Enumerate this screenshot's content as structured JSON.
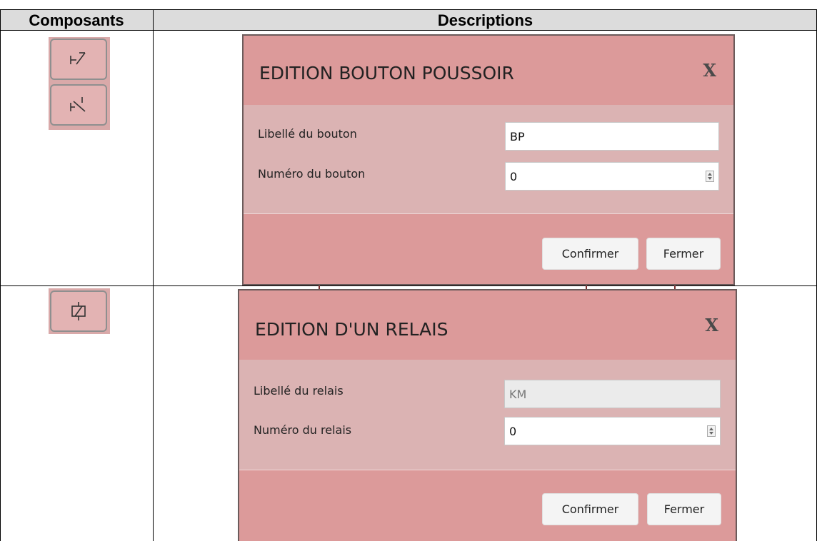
{
  "table": {
    "headers": {
      "components": "Composants",
      "descriptions": "Descriptions"
    }
  },
  "rows": [
    {
      "component_icons": [
        "push-button-no-icon",
        "push-button-nc-icon"
      ],
      "dialog": {
        "title": "EDITION BOUTON POUSSOIR",
        "close": "X",
        "fields": [
          {
            "label": "Libellé du bouton",
            "value": "BP",
            "type": "text",
            "disabled": false
          },
          {
            "label": "Numéro du bouton",
            "value": "0",
            "type": "number",
            "disabled": false
          }
        ],
        "buttons": {
          "confirm": "Confirmer",
          "close": "Fermer"
        }
      }
    },
    {
      "component_icons": [
        "relay-coil-icon"
      ],
      "dialog": {
        "title": "EDITION D'UN RELAIS",
        "close": "X",
        "fields": [
          {
            "label": "Libellé du relais",
            "value": "KM",
            "type": "text",
            "disabled": true
          },
          {
            "label": "Numéro du relais",
            "value": "0",
            "type": "number",
            "disabled": false
          }
        ],
        "buttons": {
          "confirm": "Confirmer",
          "close": "Fermer"
        }
      }
    }
  ],
  "colors": {
    "dialog_header": "#dc9a9a",
    "dialog_body": "#dbb3b3",
    "component_button": "#e3b3b3",
    "table_header": "#dcdcdc"
  }
}
